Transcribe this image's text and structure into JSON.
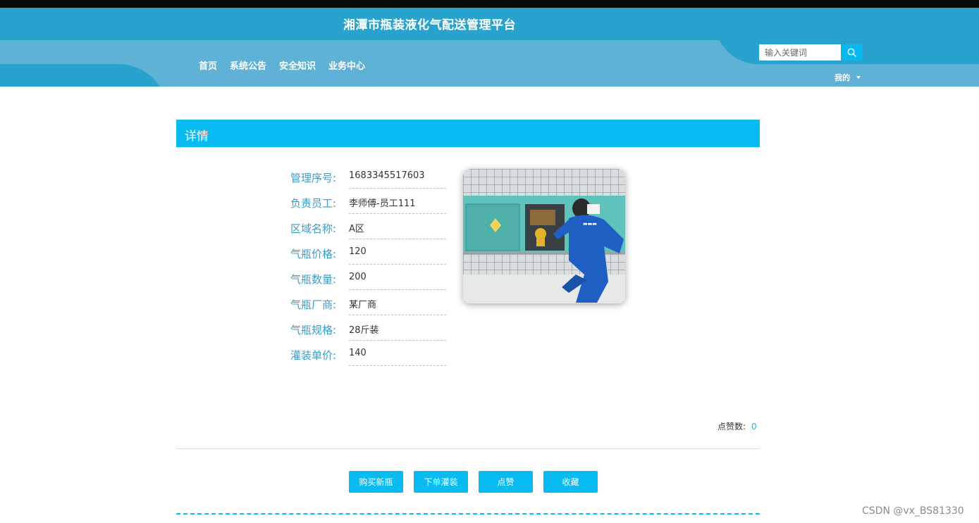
{
  "header": {
    "site_title": "湘潭市瓶装液化气配送管理平台",
    "nav": [
      "首页",
      "系统公告",
      "安全知识",
      "业务中心"
    ],
    "search_placeholder": "输入关键词",
    "my_menu_label": "我的"
  },
  "detail": {
    "section_title": "详情",
    "fields": [
      {
        "label": "管理序号:",
        "value": "1683345517603"
      },
      {
        "label": "负责员工:",
        "value": "李师傅-员工111"
      },
      {
        "label": "区域名称:",
        "value": "A区"
      },
      {
        "label": "气瓶价格:",
        "value": "120"
      },
      {
        "label": "气瓶数量:",
        "value": "200"
      },
      {
        "label": "气瓶厂商:",
        "value": "某厂商"
      },
      {
        "label": "气瓶规格:",
        "value": "28斤装"
      },
      {
        "label": "灌装单价:",
        "value": "140"
      }
    ],
    "likes_label": "点赞数:",
    "likes_count": "0"
  },
  "actions": {
    "buy_new": "购买新瓶",
    "order_fill": "下单灌装",
    "like": "点赞",
    "favorite": "收藏"
  },
  "watermark": "CSDN @vx_BS81330",
  "colors": {
    "header_dark": "#27a3cd",
    "header_light": "#5fb2d6",
    "accent": "#08bbf0",
    "label_blue": "#3a9cc8"
  }
}
